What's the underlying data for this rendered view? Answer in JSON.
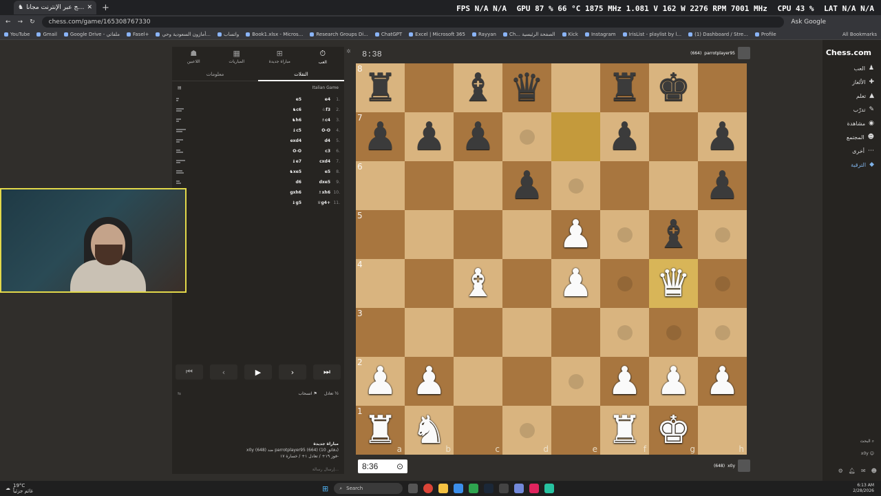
{
  "browser": {
    "tab_title": "العب الشطرنج عبر الإنترنت مجاناً",
    "url": "chess.com/game/165308767330",
    "ask_google": "Ask Google",
    "bookmarks": [
      "YouTube",
      "Gmail",
      "Google Drive - ملفاتي",
      "Fasel+",
      "أمازون السعودية وحي...",
      "واتساب",
      "Book1.xlsx - Micros...",
      "Research Groups Di...",
      "ChatGPT",
      "Excel | Microsoft 365",
      "Rayyan",
      "Ch... الصفحة الرئيسية",
      "Kick",
      "Instagram",
      "IrisList - playlist by l...",
      "(1) Dashboard / Stre...",
      "Profile"
    ],
    "all_bookmarks": "All Bookmarks"
  },
  "overlay": {
    "fps": "FPS N/A N/A",
    "gpu": "GPU 87 % 66 °C 1875 MHz 1.081 V 162 W 2276 RPM 7001 MHz",
    "cpu": "CPU 43 %",
    "lat": "LAT N/A N/A"
  },
  "left_panel": {
    "tabs": [
      {
        "label": "اللاعبين",
        "icon": "players-icon",
        "glyph": "☗"
      },
      {
        "label": "المباريات",
        "icon": "games-icon",
        "glyph": "▦"
      },
      {
        "label": "مباراة جديدة",
        "icon": "new-game-icon",
        "glyph": "⊞"
      },
      {
        "label": "العب",
        "icon": "play-icon",
        "glyph": "⏱"
      }
    ],
    "subtabs": {
      "info": "معلومات",
      "moves": "النقلات"
    },
    "opening": "Italian Game",
    "moves": [
      {
        "n": "1.",
        "white": "e4",
        "black": "e5"
      },
      {
        "n": "2.",
        "white": "♘f3",
        "black": "♞c6"
      },
      {
        "n": "3.",
        "white": "♗c4",
        "black": "♞h6"
      },
      {
        "n": "4.",
        "white": "O-O",
        "black": "♝c5"
      },
      {
        "n": "5.",
        "white": "d4",
        "black": "exd4"
      },
      {
        "n": "6.",
        "white": "c3",
        "black": "O-O"
      },
      {
        "n": "7.",
        "white": "cxd4",
        "black": "♝e7"
      },
      {
        "n": "8.",
        "white": "e5",
        "black": "♞xe5"
      },
      {
        "n": "9.",
        "white": "dxe5",
        "black": "d6"
      },
      {
        "n": "10.",
        "white": "♗xh6",
        "black": "gxh6"
      },
      {
        "n": "11.",
        "white": "♕g4+",
        "black": "♝g5"
      }
    ],
    "actions": {
      "draw": "تعادل ½",
      "resign": "انسحاب ⚑"
    },
    "game_info": {
      "title": "مباراة جديدة",
      "line1": "x0y (648) ضد parrotplayer95 (664) (10 دقائق)",
      "line2": "فوز ۱۹+ / تعادل ۱+ / خسارة ۱۷-"
    },
    "chat_placeholder": "إرسال رسالة..."
  },
  "game": {
    "top_clock": "8:38",
    "top_player": "parrotplayer95",
    "top_rating": "(664)",
    "bottom_clock": "8:36",
    "bottom_player": "x0y",
    "bottom_rating": "(648)"
  },
  "board": {
    "ranks": [
      [
        "bR",
        "",
        "bB",
        "bQ",
        "",
        "bR",
        "bK",
        ""
      ],
      [
        "bP",
        "bP",
        "bP",
        "",
        "",
        "bP",
        "",
        "bP"
      ],
      [
        "",
        "",
        "",
        "bP",
        "",
        "",
        "",
        "bP"
      ],
      [
        "",
        "",
        "",
        "",
        "wP",
        "",
        "bB",
        ""
      ],
      [
        "",
        "",
        "wB",
        "",
        "wP",
        "",
        "wQ",
        ""
      ],
      [
        "",
        "",
        "",
        "",
        "",
        "",
        "",
        ""
      ],
      [
        "wP",
        "wP",
        "",
        "",
        "",
        "wP",
        "wP",
        "wP"
      ],
      [
        "wR",
        "wN",
        "",
        "",
        "",
        "wR",
        "wK",
        ""
      ]
    ],
    "rank_labels": [
      "8",
      "7",
      "6",
      "5",
      "4",
      "3",
      "2",
      "1"
    ],
    "file_labels": [
      "a",
      "b",
      "c",
      "d",
      "e",
      "f",
      "g",
      "h"
    ],
    "highlight": [
      "e7",
      "g4"
    ],
    "hints": [
      "d7",
      "e6",
      "f5",
      "h5",
      "f4",
      "h4",
      "f3",
      "g3",
      "h3",
      "e2",
      "d1"
    ]
  },
  "right_nav": {
    "logo": "Chess.com",
    "items": [
      {
        "label": "العب",
        "glyph": "♟"
      },
      {
        "label": "الألغاز",
        "glyph": "✚"
      },
      {
        "label": "تعلم",
        "glyph": "▲"
      },
      {
        "label": "تدرّب",
        "glyph": "✎"
      },
      {
        "label": "مشاهدة",
        "glyph": "◉"
      },
      {
        "label": "المجتمع",
        "glyph": "☻"
      },
      {
        "label": "أخرى",
        "glyph": "⋯"
      },
      {
        "label": "الترقية",
        "glyph": "◆"
      }
    ],
    "search": "البحث",
    "user": "x0y"
  },
  "taskbar": {
    "weather": "19°C",
    "weather_sub": "غائم جزئياً",
    "search": "Search",
    "time": "6:13 AM",
    "date": "2/28/2026"
  }
}
